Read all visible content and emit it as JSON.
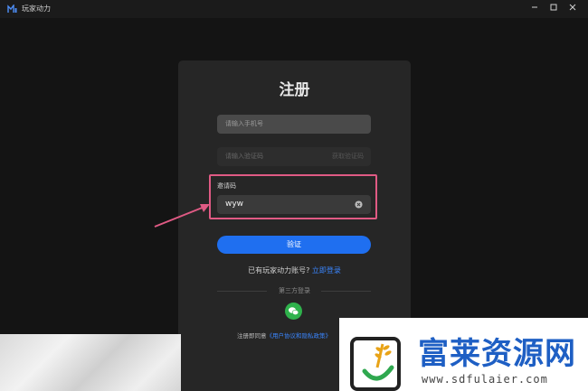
{
  "window": {
    "title": "玩家动力"
  },
  "register": {
    "title": "注册",
    "phone_placeholder": "请输入手机号",
    "code_placeholder": "请输入验证码",
    "get_code_label": "获取验证码",
    "invite_label": "邀请码",
    "invite_value": "wyw",
    "verify_label": "验证",
    "have_account_text": "已有玩家动力账号?",
    "login_link": "立即登录",
    "third_party_label": "第三方登录",
    "agree_text": "注册即同意",
    "agree_link": "《用户协议和隐私政策》"
  },
  "watermark": {
    "name": "富莱资源网",
    "url": "www.sdfulaier.com"
  },
  "colors": {
    "accent": "#1f6ff0",
    "highlight": "#e05a84",
    "wechat": "#2fb24c"
  }
}
